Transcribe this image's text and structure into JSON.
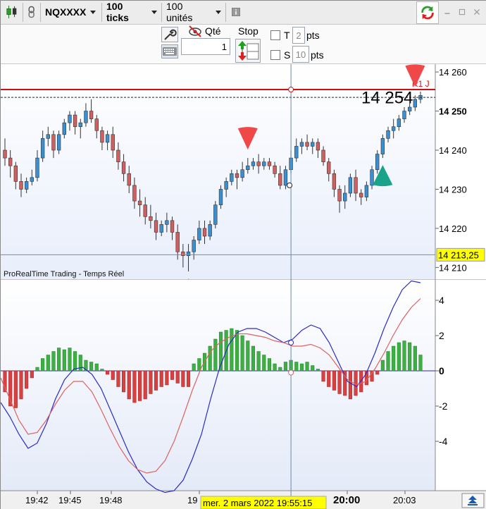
{
  "toolbar": {
    "instrument": "NQXXXX",
    "interval": "100 ticks",
    "units": "100 unités",
    "info_icon": "info-icon",
    "candle_icon": "candlestick-icon",
    "link_icon": "chain-link-icon",
    "refresh_icon": "sync-icon"
  },
  "order_panel": {
    "qty_label": "Qté",
    "qty_value": "1",
    "stop_label": "Stop",
    "t_label": "T",
    "t_value": "2",
    "t_unit": "pts",
    "s_label": "S",
    "s_value": "10",
    "s_unit": "pts"
  },
  "price_axis": {
    "ticks": [
      "14 260",
      "14 250",
      "14 240",
      "14 230",
      "14 220",
      "14 210"
    ],
    "current_price_label": "14 213,25",
    "big_price": "14 254",
    "level_label": "R1 J",
    "watermark": "ProRealTime Trading - Temps Réel"
  },
  "indicator_axis": {
    "ticks": [
      "4",
      "2",
      "0",
      "-2",
      "-4"
    ]
  },
  "time_axis": {
    "ticks": [
      "19:42",
      "19:45",
      "19:48",
      "19",
      "20:00",
      "20:03"
    ],
    "cursor_label": "mer. 2 mars 2022 19:55:15"
  },
  "colors": {
    "up": "#3a8fd0",
    "down": "#d06060",
    "hist_up": "#3cb043",
    "hist_down": "#d94040",
    "resistance": "#d01010",
    "signal_arrow_up": "#1aa38b",
    "signal_arrow_down": "#f04848",
    "macd_line": "#2a2ac8",
    "signal_line": "#e06060",
    "cursor_label_bg": "#ffff00"
  },
  "chart_data": [
    {
      "type": "candlestick",
      "title": "",
      "ylim": [
        14207,
        14262
      ],
      "resistance_level": 14255.5,
      "current_price": 14213.25,
      "dashed_level": 14253.5,
      "candles": [
        [
          14240,
          14243,
          14236,
          14238
        ],
        [
          14238,
          14240,
          14233,
          14236
        ],
        [
          14236,
          14237,
          14230,
          14232
        ],
        [
          14232,
          14234,
          14228,
          14230
        ],
        [
          14230,
          14233,
          14229,
          14232
        ],
        [
          14232,
          14235,
          14231,
          14233
        ],
        [
          14233,
          14240,
          14232,
          14238
        ],
        [
          14238,
          14245,
          14237,
          14243
        ],
        [
          14243,
          14246,
          14241,
          14244
        ],
        [
          14244,
          14245,
          14238,
          14240
        ],
        [
          14240,
          14245,
          14239,
          14244
        ],
        [
          14244,
          14248,
          14243,
          14247
        ],
        [
          14247,
          14250,
          14245,
          14249
        ],
        [
          14249,
          14250,
          14244,
          14246
        ],
        [
          14246,
          14248,
          14243,
          14247
        ],
        [
          14247,
          14252,
          14246,
          14250
        ],
        [
          14250,
          14253,
          14247,
          14248
        ],
        [
          14248,
          14249,
          14243,
          14245
        ],
        [
          14245,
          14246,
          14240,
          14242
        ],
        [
          14242,
          14245,
          14240,
          14244
        ],
        [
          14244,
          14246,
          14238,
          14240
        ],
        [
          14240,
          14242,
          14235,
          14237
        ],
        [
          14237,
          14239,
          14232,
          14234
        ],
        [
          14234,
          14236,
          14229,
          14231
        ],
        [
          14231,
          14233,
          14225,
          14227
        ],
        [
          14227,
          14230,
          14223,
          14226
        ],
        [
          14226,
          14228,
          14221,
          14223
        ],
        [
          14223,
          14226,
          14220,
          14222
        ],
        [
          14222,
          14224,
          14217,
          14219
        ],
        [
          14219,
          14222,
          14218,
          14221
        ],
        [
          14221,
          14224,
          14219,
          14222
        ],
        [
          14222,
          14223,
          14217,
          14219
        ],
        [
          14219,
          14221,
          14212,
          14214
        ],
        [
          14214,
          14216,
          14210,
          14213
        ],
        [
          14213,
          14216,
          14209,
          14214
        ],
        [
          14214,
          14218,
          14212,
          14217
        ],
        [
          14217,
          14222,
          14216,
          14220
        ],
        [
          14220,
          14222,
          14216,
          14218
        ],
        [
          14218,
          14222,
          14217,
          14221
        ],
        [
          14221,
          14227,
          14220,
          14226
        ],
        [
          14226,
          14231,
          14225,
          14230
        ],
        [
          14230,
          14233,
          14228,
          14232
        ],
        [
          14232,
          14235,
          14231,
          14234
        ],
        [
          14234,
          14235,
          14230,
          14233
        ],
        [
          14233,
          14237,
          14232,
          14235
        ],
        [
          14235,
          14238,
          14234,
          14236
        ],
        [
          14236,
          14238,
          14235,
          14237
        ],
        [
          14237,
          14239,
          14234,
          14236
        ],
        [
          14236,
          14238,
          14235,
          14237
        ],
        [
          14237,
          14238,
          14235,
          14236
        ],
        [
          14236,
          14237,
          14233,
          14234
        ],
        [
          14234,
          14236,
          14230,
          14231
        ],
        [
          14231,
          14236,
          14230,
          14235
        ],
        [
          14235,
          14240,
          14234,
          14238
        ],
        [
          14238,
          14243,
          14237,
          14241
        ],
        [
          14241,
          14243,
          14239,
          14242
        ],
        [
          14242,
          14244,
          14240,
          14241
        ],
        [
          14241,
          14243,
          14239,
          14242
        ],
        [
          14242,
          14243,
          14238,
          14240
        ],
        [
          14240,
          14241,
          14236,
          14237
        ],
        [
          14237,
          14238,
          14232,
          14234
        ],
        [
          14234,
          14235,
          14228,
          14230
        ],
        [
          14230,
          14231,
          14224,
          14227
        ],
        [
          14227,
          14231,
          14225,
          14229
        ],
        [
          14229,
          14234,
          14228,
          14233
        ],
        [
          14233,
          14235,
          14227,
          14229
        ],
        [
          14229,
          14230,
          14226,
          14228
        ],
        [
          14228,
          14232,
          14227,
          14231
        ],
        [
          14231,
          14236,
          14230,
          14235
        ],
        [
          14235,
          14240,
          14234,
          14239
        ],
        [
          14239,
          14244,
          14238,
          14243
        ],
        [
          14243,
          14246,
          14242,
          14245
        ],
        [
          14245,
          14248,
          14243,
          14246
        ],
        [
          14246,
          14249,
          14245,
          14248
        ],
        [
          14248,
          14251,
          14247,
          14250
        ],
        [
          14250,
          14252,
          14249,
          14251
        ],
        [
          14251,
          14254,
          14250,
          14253
        ],
        [
          14253,
          14255,
          14252,
          14254
        ]
      ],
      "signals": [
        {
          "kind": "buy",
          "index": 34
        },
        {
          "kind": "sell",
          "index": 45
        },
        {
          "kind": "buy",
          "index": 70
        },
        {
          "kind": "sell",
          "index": 76
        }
      ]
    },
    {
      "type": "bar",
      "title": "",
      "ylim": [
        -6.8,
        5.2
      ],
      "histogram": [
        -1.2,
        -2.0,
        -2.1,
        -1.6,
        -1.0,
        -0.4,
        0.2,
        0.7,
        0.9,
        1.1,
        1.3,
        1.2,
        1.3,
        1.1,
        0.9,
        0.6,
        0.5,
        0.4,
        0.1,
        -0.2,
        -0.5,
        -0.9,
        -1.2,
        -1.6,
        -1.8,
        -1.7,
        -1.6,
        -1.3,
        -1.1,
        -0.9,
        -0.8,
        -0.5,
        -0.7,
        -0.9,
        -0.9,
        0.4,
        0.7,
        1.0,
        1.4,
        1.8,
        2.2,
        2.3,
        2.4,
        2.3,
        2.0,
        1.7,
        1.4,
        1.1,
        0.9,
        0.7,
        0.4,
        0.2,
        0.5,
        0.6,
        0.5,
        0.4,
        0.5,
        0.3,
        0.1,
        -0.6,
        -0.9,
        -1.1,
        -1.3,
        -1.4,
        -1.6,
        -1.4,
        -1.2,
        -0.8,
        -0.6,
        -0.2,
        0.6,
        1.1,
        1.4,
        1.6,
        1.7,
        1.6,
        1.4,
        0.9
      ],
      "series": [
        {
          "values": [
            -1.8,
            -2.6,
            -3.6,
            -4.4,
            -4.1,
            -3.0,
            -1.6,
            -0.5,
            0.1,
            0.2,
            -0.2,
            -1.0,
            -2.2,
            -3.4,
            -4.6,
            -5.6,
            -6.3,
            -6.7,
            -6.9,
            -6.8,
            -6.2,
            -5.0,
            -3.6,
            -1.6,
            0.2,
            1.5,
            2.2,
            2.4,
            2.4,
            2.2,
            1.9,
            1.6,
            1.8,
            2.3,
            2.6,
            2.4,
            1.6,
            0.5,
            -0.6,
            -0.9,
            -0.2,
            1.0,
            2.4,
            3.6,
            4.6,
            5.1,
            5.0
          ]
        },
        {
          "values": [
            -0.4,
            -1.6,
            -2.8,
            -3.6,
            -3.5,
            -2.8,
            -1.9,
            -1.1,
            -0.6,
            -0.6,
            -1.2,
            -2.2,
            -3.3,
            -4.3,
            -5.1,
            -5.6,
            -5.8,
            -5.7,
            -5.1,
            -4.0,
            -2.6,
            -1.1,
            0.2,
            1.1,
            1.6,
            1.9,
            2.1,
            2.1,
            2.0,
            1.9,
            1.7,
            1.6,
            1.4,
            1.4,
            1.5,
            1.3,
            0.9,
            0.2,
            -0.5,
            -0.8,
            -0.6,
            0.1,
            1.0,
            2.0,
            2.9,
            3.6,
            4.1
          ]
        }
      ]
    }
  ]
}
